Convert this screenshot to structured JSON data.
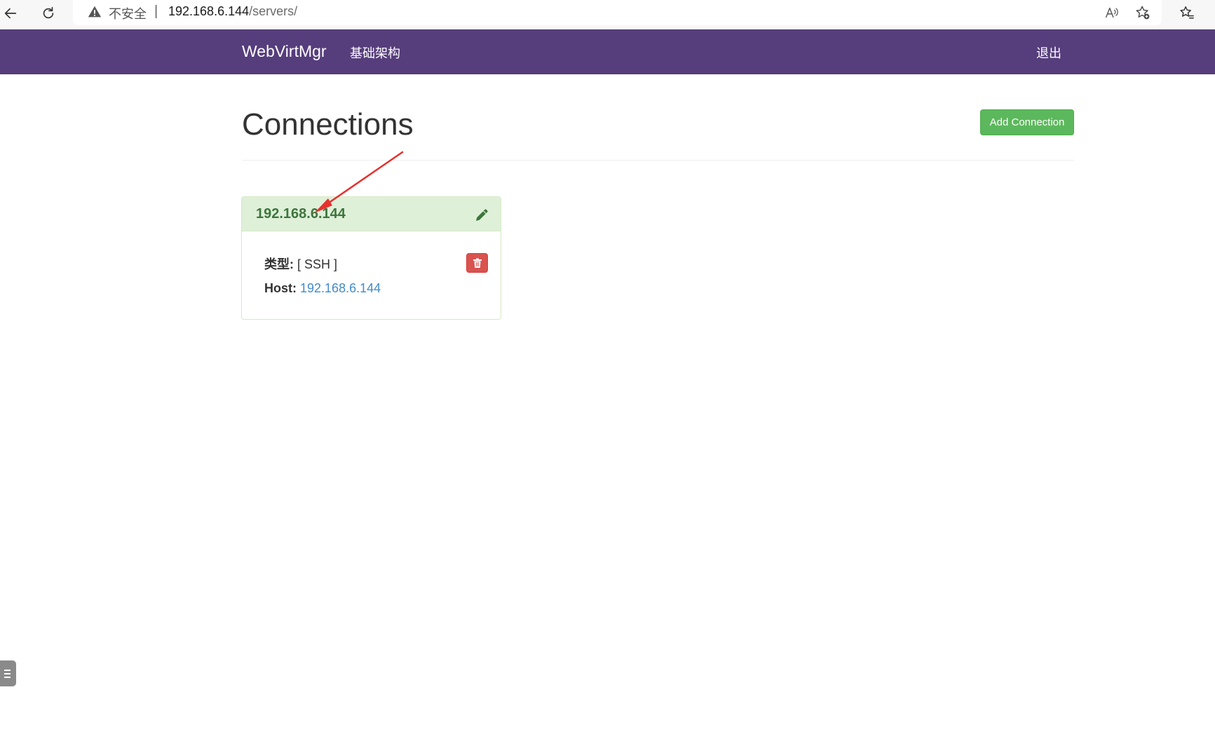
{
  "browser": {
    "insecure_label": "不安全",
    "separator": "|",
    "url_host": "192.168.6.144",
    "url_path": "/servers/"
  },
  "navbar": {
    "brand": "WebVirtMgr",
    "infrastructure_link": "基础架构",
    "logout_link": "退出"
  },
  "page": {
    "title": "Connections",
    "add_button": "Add Connection"
  },
  "connection": {
    "name": "192.168.6.144",
    "type_label": "类型:",
    "type_value": "[ SSH ]",
    "host_label": "Host:",
    "host_value": "192.168.6.144"
  },
  "colors": {
    "navbar": "#563d7c",
    "success": "#5cb85c",
    "danger": "#d9534f",
    "panel_heading": "#dff0d8",
    "panel_title": "#3c763d",
    "link": "#428bca",
    "annotation": "#e8302e"
  },
  "icons": [
    "back-icon",
    "reload-icon",
    "warning-icon",
    "read-aloud-icon",
    "add-favorite-icon",
    "favorites-icon",
    "pencil-icon",
    "trash-icon",
    "menu-icon"
  ]
}
